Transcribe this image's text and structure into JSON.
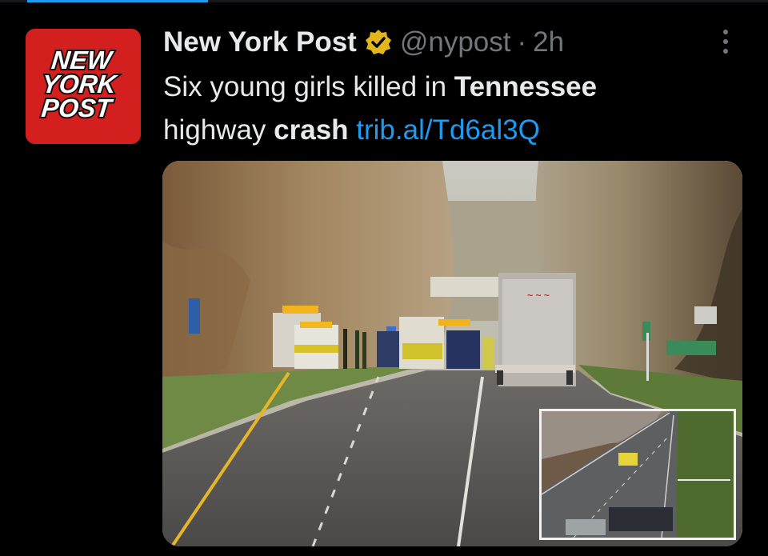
{
  "tweet": {
    "display_name": "New York Post",
    "handle": "@nypost",
    "separator": "·",
    "time": "2h",
    "verified_badge": "gold-verified-icon",
    "text_parts": {
      "t1": "Six young girls killed in ",
      "b1": "Tennessee",
      "t2": "highway ",
      "b2": "crash",
      "link": "trib.al/Td6al3Q"
    }
  },
  "avatar": {
    "logo_lines": [
      "NEW",
      "YORK",
      "POST"
    ],
    "brand_color": "#d41f1f"
  },
  "media": {
    "main_image": "highway-crash-scene-photo",
    "inset_image": "aerial-crash-scene-photo"
  },
  "colors": {
    "background": "#000000",
    "text": "#e7e9ea",
    "muted": "#71767b",
    "link": "#1d9bf0",
    "verified_gold": "#e2b719"
  }
}
